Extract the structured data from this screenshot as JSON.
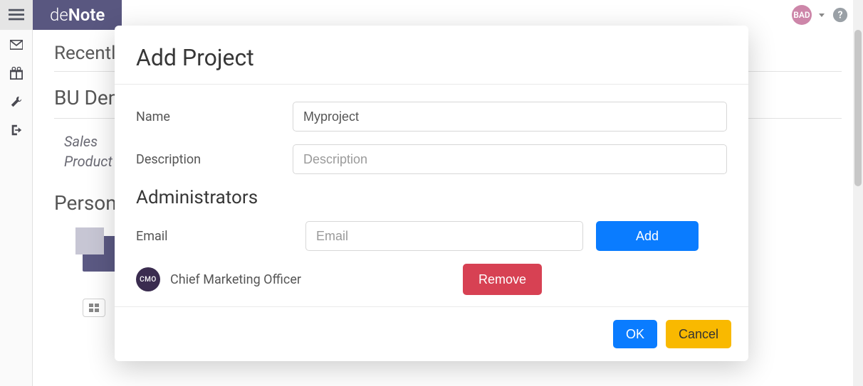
{
  "brand": {
    "prefix": "de",
    "bold": "Note"
  },
  "user_badge": "BAD",
  "sidebar": {
    "icons": [
      "envelope-icon",
      "gift-icon",
      "wrench-icon",
      "exit-icon"
    ]
  },
  "main": {
    "recent_title": "Recentl",
    "bu_title": "BU Dem",
    "links": [
      "Sales",
      "Product"
    ],
    "personal_title": "Persona"
  },
  "modal": {
    "title": "Add Project",
    "name_label": "Name",
    "name_value": "Myproject",
    "desc_label": "Description",
    "desc_placeholder": "Description",
    "admins_title": "Administrators",
    "email_label": "Email",
    "email_placeholder": "Email",
    "add_label": "Add",
    "admin_avatar_text": "CMO",
    "admin_name": "Chief Marketing Officer",
    "remove_label": "Remove",
    "ok_label": "OK",
    "cancel_label": "Cancel"
  }
}
